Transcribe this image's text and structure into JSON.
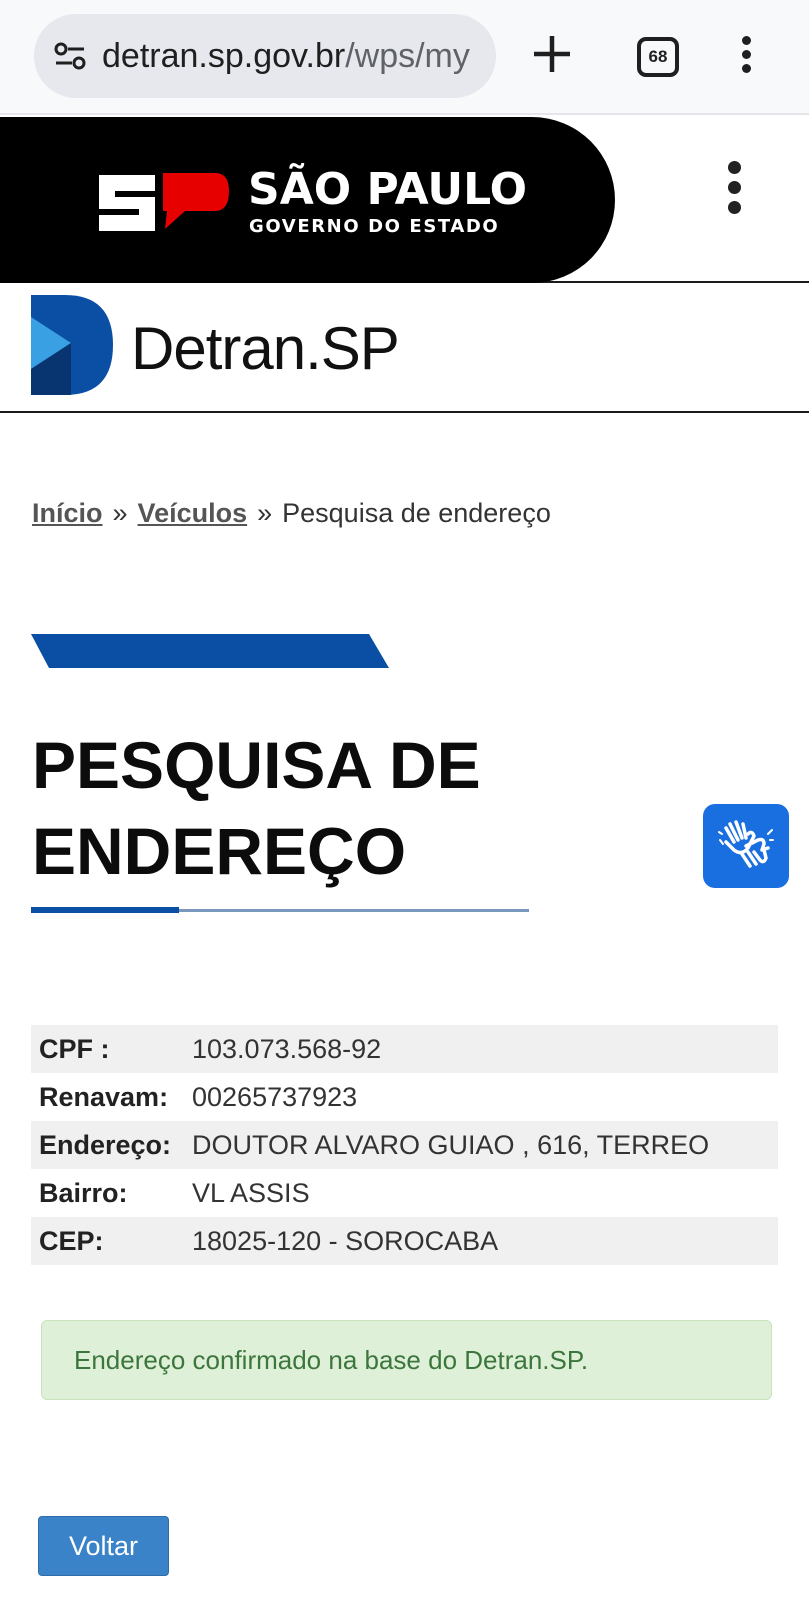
{
  "browser": {
    "url_domain": "detran.sp.gov.br",
    "url_path": "/wps/my",
    "tab_count": "68"
  },
  "gov_header": {
    "title": "SÃO PAULO",
    "subtitle": "GOVERNO DO ESTADO",
    "logo_text": "SP"
  },
  "detran": {
    "name_main": "Detran",
    "name_suffix": ".SP"
  },
  "breadcrumb": {
    "items": [
      "Início",
      "Veículos",
      "Pesquisa de endereço"
    ],
    "separator": "»"
  },
  "page": {
    "title": "PESQUISA DE ENDEREÇO"
  },
  "record": {
    "rows": [
      {
        "label": "CPF :",
        "value": "103.073.568-92"
      },
      {
        "label": "Renavam:",
        "value": "00265737923"
      },
      {
        "label": "Endereço:",
        "value": "DOUTOR ALVARO GUIAO , 616, TERREO"
      },
      {
        "label": "Bairro:",
        "value": "VL ASSIS"
      },
      {
        "label": "CEP:",
        "value": "18025-120 - SOROCABA"
      }
    ]
  },
  "alert": {
    "message": "Endereço confirmado na base do Detran.SP."
  },
  "actions": {
    "back_label": "Voltar"
  },
  "colors": {
    "brand_blue": "#0b4fa5",
    "sp_red": "#e60000",
    "libras_blue": "#1a6fe0",
    "success_bg": "#dff0d8",
    "success_text": "#3c763d",
    "button_blue": "#3b83c9"
  },
  "icons": {
    "site_info": "tune-icon",
    "new_tab": "plus-icon",
    "tab_switcher": "tabs-icon",
    "browser_menu": "more-vert-icon",
    "site_menu": "more-vert-icon",
    "accessibility": "sign-language-hands-icon"
  }
}
